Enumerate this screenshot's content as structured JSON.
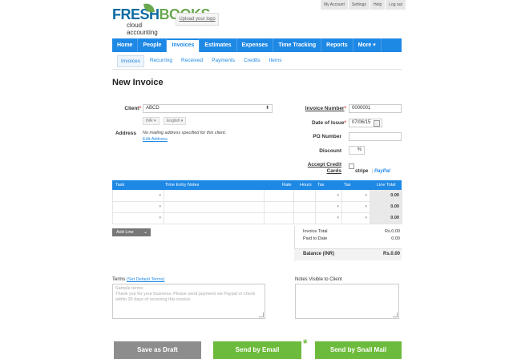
{
  "brand": {
    "name_a": "FRESH",
    "name_b": "BOOKS",
    "tagline": "cloud accounting",
    "upload_logo": "Upload your logo"
  },
  "top_links": [
    "My Account",
    "Settings",
    "Help",
    "Log out"
  ],
  "nav": [
    "Home",
    "People",
    "Invoices",
    "Estimates",
    "Expenses",
    "Time Tracking",
    "Reports",
    "More ▾"
  ],
  "subnav": [
    "Invoices",
    "Recurring",
    "Received",
    "Payments",
    "Credits",
    "Items"
  ],
  "page_title": "New Invoice",
  "form": {
    "client_label": "Client",
    "client_value": "ABCD",
    "currency": "INR ▾",
    "language": "English ▾",
    "address_label": "Address",
    "address_note": "No mailing address specified for this client.",
    "edit_address": "Edit Address",
    "invoice_number_label": "Invoice Number",
    "invoice_number": "0000001",
    "date_label": "Date of Issue",
    "date_value": "07/06/15",
    "po_label": "PO Number",
    "po_value": "",
    "discount_label": "Discount",
    "discount_unit": "%",
    "accept_label_1": "Accept Credit",
    "accept_label_2": "Cards",
    "stripe": "stripe",
    "paypal": "PayPal"
  },
  "table": {
    "headers": [
      "Task",
      "Time Entry Notes",
      "Rate",
      "Hours",
      "Tax",
      "Tax",
      "Line Total"
    ],
    "rows": [
      {
        "line_total": "0.00"
      },
      {
        "line_total": "0.00"
      },
      {
        "line_total": "0.00"
      }
    ]
  },
  "add_line": "Add Line",
  "totals": {
    "invoice_total_label": "Invoice Total",
    "invoice_total": "Rs.0.00",
    "paid_label": "Paid to Date",
    "paid": "0.00",
    "balance_label": "Balance (INR)",
    "balance": "Rs.0.00"
  },
  "terms": {
    "label": "Terms",
    "default_link": "(Set Default Terms)",
    "placeholder": "Sample terms:\nThank you for your business. Please send payment via Paypal or check within 30 days of receiving this invoice."
  },
  "notes": {
    "label": "Notes Visible to Client",
    "value": ""
  },
  "buttons": {
    "draft": "Save as Draft",
    "email": "Send by Email",
    "snail": "Send by Snail Mail",
    "asterisk": "*"
  }
}
